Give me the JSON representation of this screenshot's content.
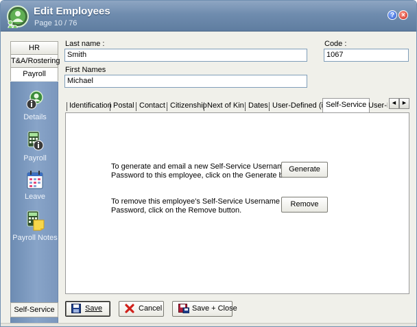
{
  "window": {
    "title": "Edit Employees",
    "page": "Page 10 / 76",
    "help_label": "?",
    "close_label": "×"
  },
  "nav": {
    "tabs": [
      "HR",
      "T&A/Rostering",
      "Payroll"
    ],
    "active_tab": "Payroll",
    "items": [
      {
        "label": "Details",
        "icon": "person-info-icon"
      },
      {
        "label": "Payroll",
        "icon": "calculator-info-icon"
      },
      {
        "label": "Leave",
        "icon": "calendar-icon"
      },
      {
        "label": "Payroll Notes",
        "icon": "calculator-note-icon"
      }
    ],
    "bottom": "Self-Service"
  },
  "form": {
    "last_name_label": "Last name :",
    "last_name_value": "Smith",
    "first_names_label": "First Names",
    "first_names_value": "Michael",
    "code_label": "Code :",
    "code_value": "1067"
  },
  "tabs": {
    "items": [
      "Identification",
      "Postal",
      "Contact",
      "Citizenship",
      "Next of Kin",
      "Dates",
      "User-Defined (i)",
      "Self-Service",
      "User-D"
    ],
    "active": "Self-Service",
    "arrow_left": "◀",
    "arrow_right": "▶"
  },
  "self_service": {
    "generate_text_line1": "To generate and email a new Self-Service Username and",
    "generate_text_line2": "Password to this employee, click on the Generate button.",
    "generate_button": "Generate",
    "remove_text_line1": "To remove this employee's Self-Service Username and",
    "remove_text_line2": "Password, click on the Remove button.",
    "remove_button": "Remove"
  },
  "buttons": {
    "save": "Save",
    "cancel": "Cancel",
    "save_close": "Save + Close"
  },
  "colors": {
    "titlebar": "#6f8cae",
    "nav_panel": "#88a4c8"
  }
}
